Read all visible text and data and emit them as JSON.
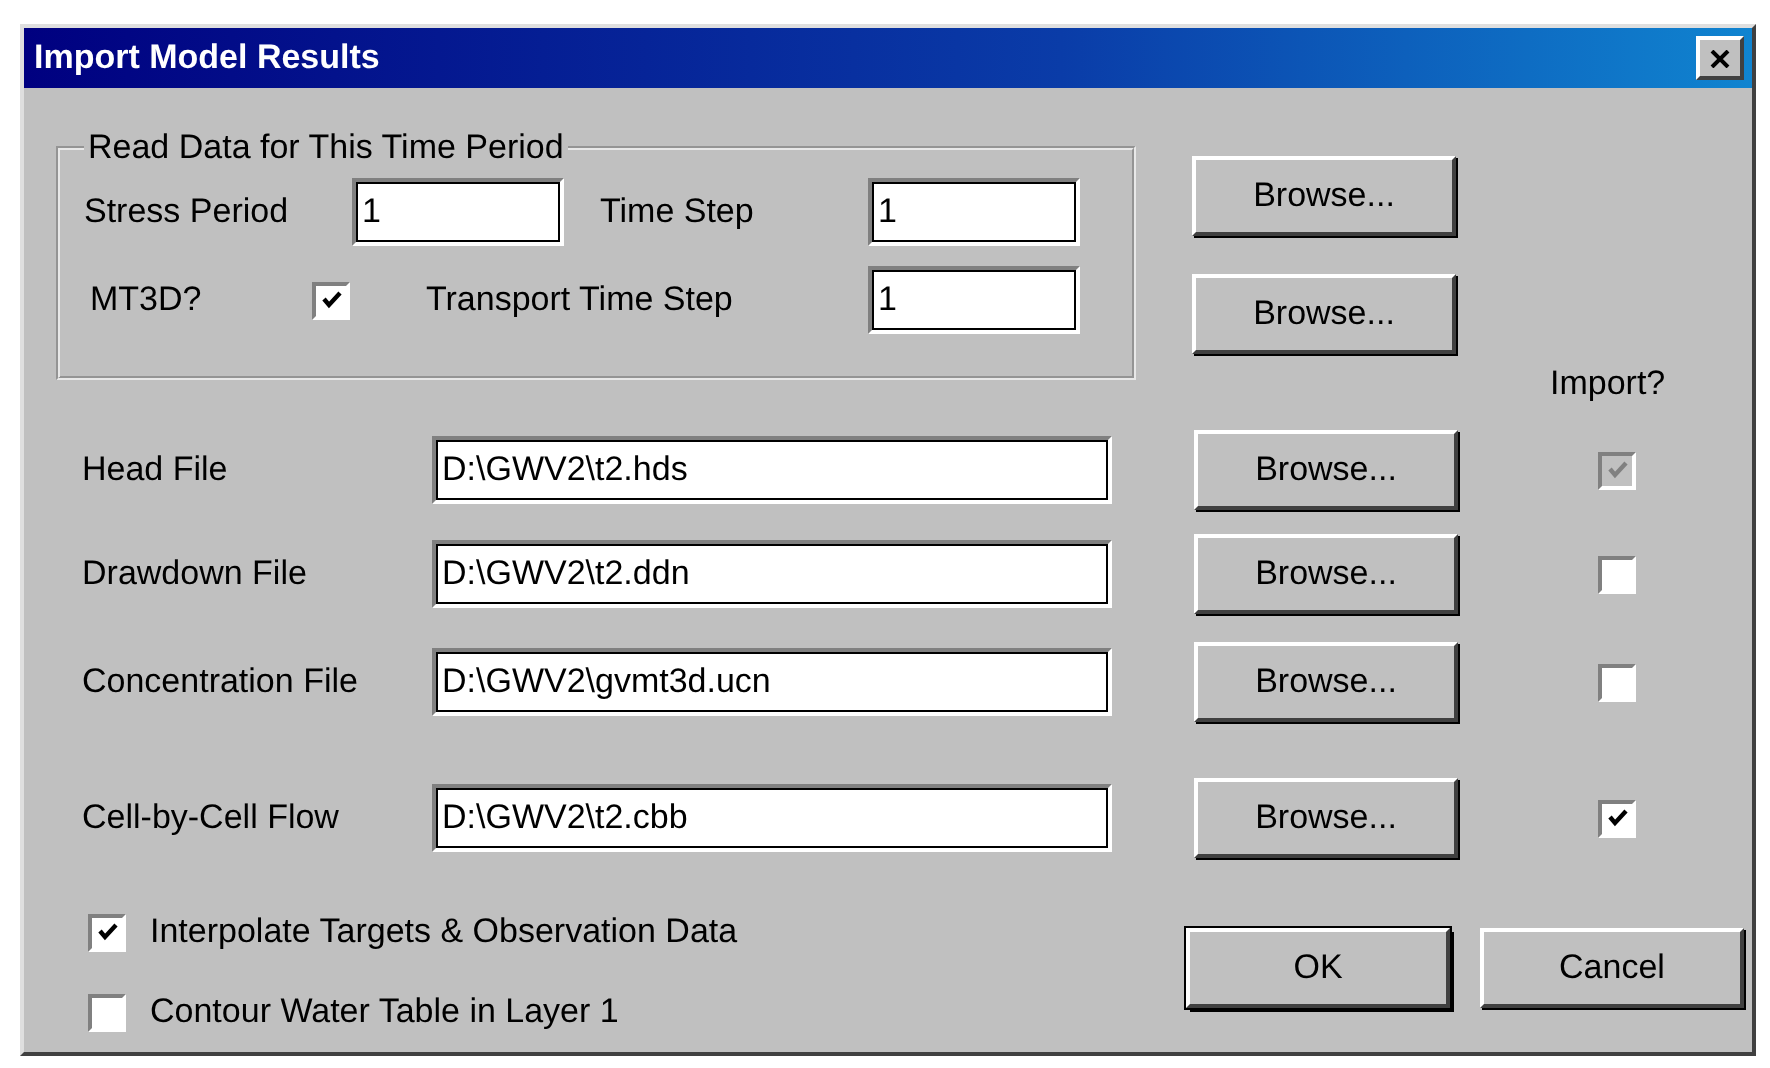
{
  "window": {
    "title": "Import Model Results"
  },
  "time_period": {
    "legend": "Read Data for This Time Period",
    "stress_period": {
      "label": "Stress Period",
      "value": "1"
    },
    "time_step": {
      "label": "Time Step",
      "value": "1"
    },
    "mt3d": {
      "label": "MT3D?",
      "checked": true
    },
    "transport_time_step": {
      "label": "Transport Time Step",
      "value": "1"
    },
    "browse_buttons": [
      "Browse...",
      "Browse..."
    ]
  },
  "import_header": "Import?",
  "files": [
    {
      "label": "Head File",
      "value": "D:\\GWV2\\t2.hds",
      "button": "Browse...",
      "import_checked": true,
      "import_disabled": true
    },
    {
      "label": "Drawdown File",
      "value": "D:\\GWV2\\t2.ddn",
      "button": "Browse...",
      "import_checked": false,
      "import_disabled": false
    },
    {
      "label": "Concentration File",
      "value": "D:\\GWV2\\gvmt3d.ucn",
      "button": "Browse...",
      "import_checked": false,
      "import_disabled": false
    },
    {
      "label": "Cell-by-Cell Flow",
      "value": "D:\\GWV2\\t2.cbb",
      "button": "Browse...",
      "import_checked": true,
      "import_disabled": false
    }
  ],
  "options": [
    {
      "label": "Interpolate Targets & Observation Data",
      "checked": true
    },
    {
      "label": "Contour Water Table in Layer 1",
      "checked": false
    }
  ],
  "buttons": [
    {
      "label": "OK",
      "default": true
    },
    {
      "label": "Cancel",
      "default": false
    }
  ]
}
